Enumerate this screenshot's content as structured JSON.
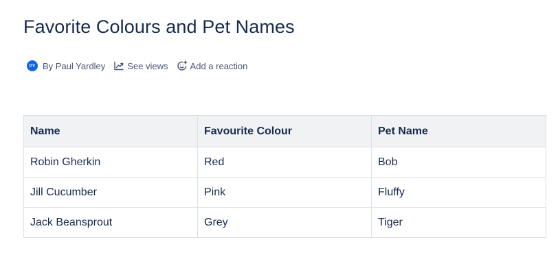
{
  "page": {
    "title": "Favorite Colours and Pet Names"
  },
  "byline": {
    "avatar_initials": "PY",
    "author": "By Paul Yardley",
    "views": "See views",
    "reaction": "Add a reaction",
    "avatar_color": "#0c66e4"
  },
  "icons": {
    "views": "line-chart-icon",
    "reaction": "smiley-add-icon"
  },
  "table": {
    "headers": [
      "Name",
      "Favourite Colour",
      "Pet Name"
    ],
    "rows": [
      [
        "Robin Gherkin",
        "Red",
        "Bob"
      ],
      [
        "Jill Cucumber",
        "Pink",
        "Fluffy"
      ],
      [
        "Jack Beansprout",
        "Grey",
        "Tiger"
      ]
    ]
  }
}
